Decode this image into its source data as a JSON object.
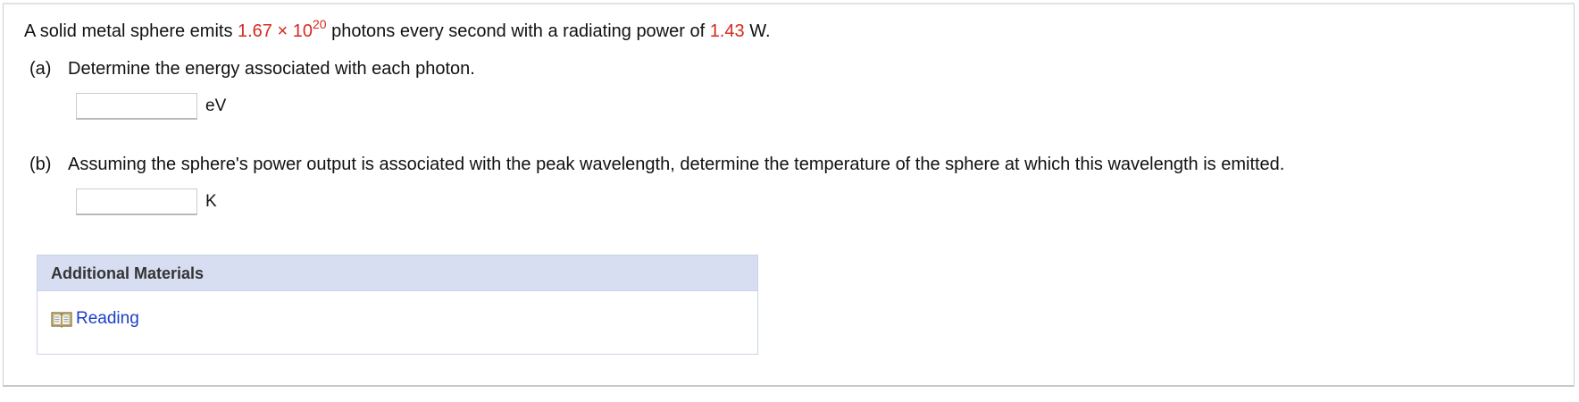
{
  "question": {
    "prefix": "A solid metal sphere emits ",
    "photon_mantissa": "1.67",
    "times_sign": " × ",
    "photon_base": "10",
    "photon_exponent": "20",
    "middle": " photons every second with a radiating power of ",
    "power_value": "1.43",
    "power_unit": " W."
  },
  "parts": [
    {
      "label": "(a)",
      "text": "Determine the energy associated with each photon.",
      "input_value": "",
      "unit": "eV"
    },
    {
      "label": "(b)",
      "text": "Assuming the sphere's power output is associated with the peak wavelength, determine the temperature of the sphere at which this wavelength is emitted.",
      "input_value": "",
      "unit": "K"
    }
  ],
  "additional_materials": {
    "title": "Additional Materials",
    "links": [
      {
        "label": "Reading",
        "icon": "book-icon"
      }
    ]
  },
  "colors": {
    "highlight_red": "#d42b1f",
    "materials_header_bg": "#d7def1",
    "link_blue": "#1a3fc9"
  }
}
